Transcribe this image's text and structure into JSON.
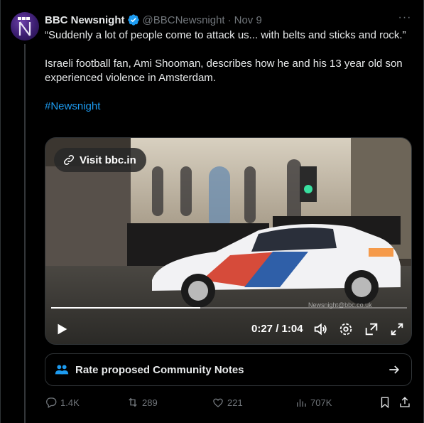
{
  "tweet": {
    "author": {
      "display_name": "BBC Newsnight",
      "handle": "@BBCNewsnight",
      "separator": "·",
      "date": "Nov 9",
      "avatar_text": "BBC",
      "avatar_icon": "newsnight-logo"
    },
    "text": {
      "line1": "“Suddenly a lot of people come to attack us... with belts and sticks and rock.”",
      "line2": "Israeli football fan, Ami Shooman, describes how he and his 13 year old son experienced violence in Amsterdam.",
      "hashtag": "#Newsnight"
    },
    "media": {
      "visit_label": "Visit bbc.in",
      "time": "0:27 / 1:04",
      "progress": 0.42,
      "watermark": "Newsnight@bbc.co.uk"
    },
    "community_notes": {
      "label": "Rate proposed Community Notes"
    },
    "actions": {
      "replies": "1.4K",
      "reposts": "289",
      "likes": "221",
      "views": "707K"
    }
  },
  "colors": {
    "background": "#000000",
    "text": "#e7e9ea",
    "muted": "#71767b",
    "accent": "#1d9bf0",
    "border": "#2f3336"
  }
}
